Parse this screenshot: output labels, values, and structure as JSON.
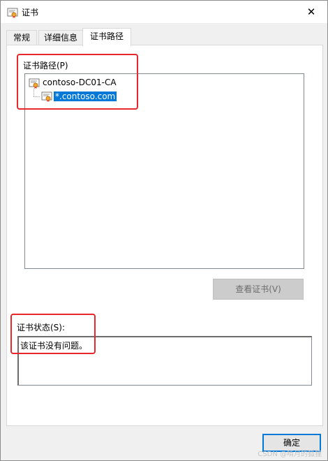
{
  "window": {
    "title": "证书",
    "close_glyph": "✕"
  },
  "tabs": [
    {
      "label": "常规"
    },
    {
      "label": "详细信息"
    },
    {
      "label": "证书路径"
    }
  ],
  "path_group": {
    "label": "证书路径(P)",
    "items": [
      {
        "label": "contoso-DC01-CA",
        "icon": "certificate-icon"
      },
      {
        "label": "*.contoso.com",
        "icon": "certificate-icon",
        "selected": true
      }
    ],
    "view_button_label": "查看证书(V)"
  },
  "status_group": {
    "label": "证书状态(S):",
    "text": "该证书没有问题。"
  },
  "footer": {
    "ok_label": "确定"
  },
  "watermark": "CSDN @啃月的狐狸",
  "colors": {
    "selection": "#0078d7",
    "highlight": "#e8262b",
    "accent": "#0078d7"
  }
}
